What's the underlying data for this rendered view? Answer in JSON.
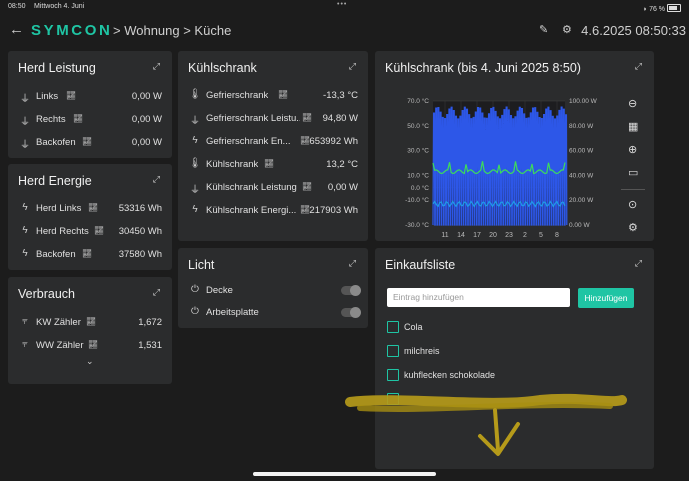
{
  "status": {
    "time": "08:50",
    "date": "Mittwoch 4. Juni",
    "dots": "•••",
    "battery": "76 %"
  },
  "header": {
    "back": "←",
    "logo": "SYMCON",
    "breadcrumb": "> Wohnung > Küche",
    "datetime": "4.6.2025 08:50:33",
    "edit_icon": "✎",
    "gear_icon": "⚙"
  },
  "herd_leistung": {
    "title": "Herd Leistung",
    "expand": "⤢",
    "rows": [
      {
        "label": "Links",
        "value": "0,00 W"
      },
      {
        "label": "Rechts",
        "value": "0,00 W"
      },
      {
        "label": "Backofen",
        "value": "0,00 W"
      }
    ]
  },
  "herd_energie": {
    "title": "Herd Energie",
    "expand": "⤢",
    "rows": [
      {
        "label": "Herd Links",
        "value": "53316 Wh"
      },
      {
        "label": "Herd Rechts",
        "value": "30450 Wh"
      },
      {
        "label": "Backofen",
        "value": "37580 Wh"
      }
    ]
  },
  "verbrauch": {
    "title": "Verbrauch",
    "expand": "⤢",
    "rows": [
      {
        "label": "KW Zähler",
        "value": "1,672"
      },
      {
        "label": "WW Zähler",
        "value": "1,531"
      }
    ],
    "more": "⌄"
  },
  "kuehlschrank": {
    "title": "Kühlschrank",
    "expand": "⤢",
    "rows": [
      {
        "label": "Gefrierschrank",
        "value": "-13,3 °C"
      },
      {
        "label": "Gefrierschrank Leistu...",
        "value": "94,80 W"
      },
      {
        "label": "Gefrierschrank En...",
        "value": "653992 Wh"
      },
      {
        "label": "Kühlschrank",
        "value": "13,2 °C"
      },
      {
        "label": "Kühlschrank Leistung",
        "value": "0,00 W"
      },
      {
        "label": "Kühlschrank Energi...",
        "value": "217903 Wh"
      }
    ]
  },
  "licht": {
    "title": "Licht",
    "expand": "⤢",
    "rows": [
      {
        "label": "Decke"
      },
      {
        "label": "Arbeitsplatte"
      }
    ]
  },
  "chart_card": {
    "title": "Kühlschrank (bis 4. Juni 2025 8:50)",
    "expand": "⤢",
    "side_icons": [
      "⊖",
      "▦",
      "⊕",
      "▭",
      "⊙",
      "⚙"
    ]
  },
  "einkaufsliste": {
    "title": "Einkaufsliste",
    "expand": "⤢",
    "placeholder": "Eintrag hinzufügen",
    "add_label": "Hinzufügen",
    "items": [
      "Cola",
      "milchreis",
      "kuhflecken schokolade"
    ]
  },
  "chart_data": {
    "type": "line",
    "y_left_ticks": [
      "70.0 °C",
      "50.0 °C",
      "30.0 °C",
      "10.0 °C",
      "0.0 °C",
      "-10.0 °C",
      "-30.0 °C"
    ],
    "y_right_ticks": [
      "100.00 W",
      "80.00 W",
      "60.00 W",
      "40.00 W",
      "20.00 W",
      "0.00 W"
    ],
    "x_ticks": [
      "11",
      "14",
      "17",
      "20",
      "23",
      "2",
      "5",
      "8"
    ],
    "y_left_range": [
      -30,
      70
    ],
    "y_right_range": [
      0,
      100
    ],
    "series": [
      {
        "color": "#2d57e8",
        "values_approx": [
          0,
          95,
          0,
          95,
          0,
          95,
          0,
          95
        ]
      },
      {
        "color": "#3ddc5a",
        "values_approx": [
          13,
          14,
          13,
          15,
          13,
          14,
          13,
          14
        ]
      },
      {
        "color": "#1f9be6",
        "values_approx": [
          -13,
          -13,
          -13,
          -13,
          -13,
          -13,
          -13,
          -13
        ]
      }
    ],
    "grid": true
  }
}
